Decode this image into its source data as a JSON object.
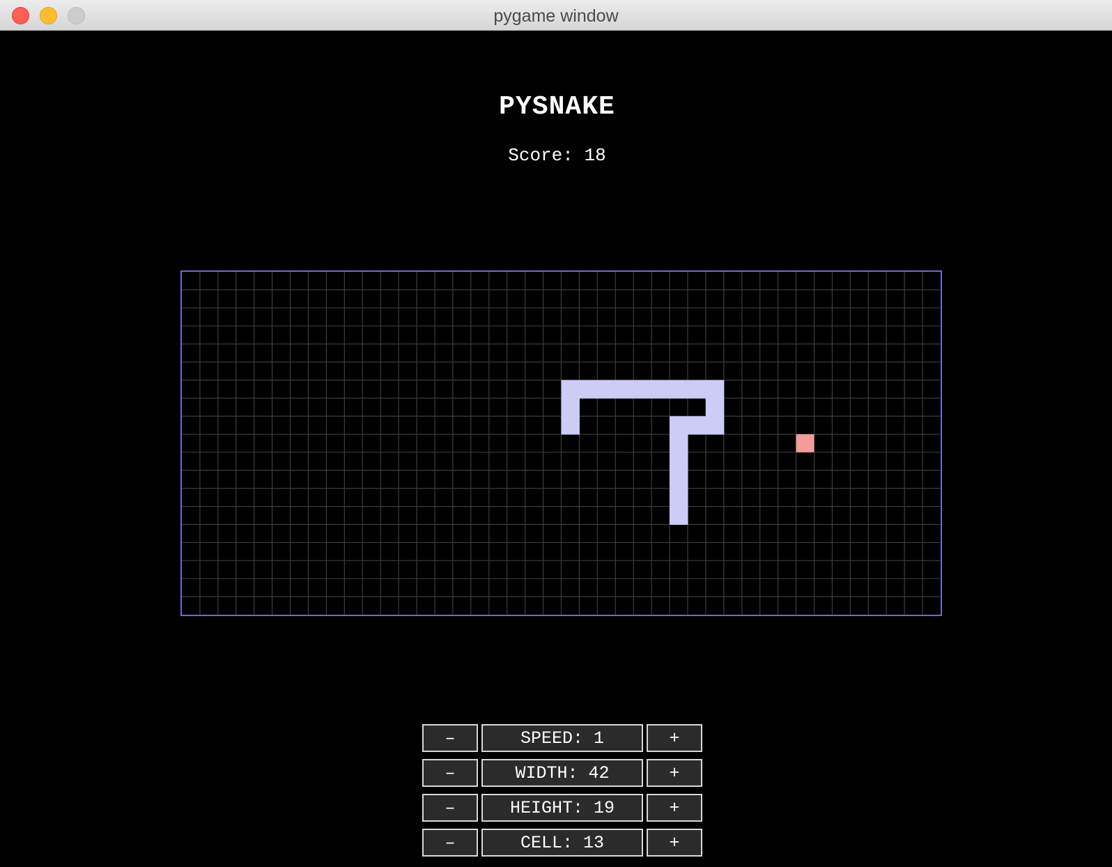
{
  "window": {
    "title": "pygame window"
  },
  "game": {
    "title": "PYSNAKE",
    "score_label": "Score:",
    "score_value": "18"
  },
  "board": {
    "columns": 42,
    "rows": 19,
    "border_color": "#6b6bd0",
    "grid_color": "#3c3c3c",
    "snake_color": "#ccccf7",
    "food_color": "#f39a9a",
    "snake_cells": [
      [
        21,
        8
      ],
      [
        21,
        7
      ],
      [
        21,
        6
      ],
      [
        22,
        6
      ],
      [
        23,
        6
      ],
      [
        24,
        6
      ],
      [
        25,
        6
      ],
      [
        26,
        6
      ],
      [
        27,
        6
      ],
      [
        28,
        6
      ],
      [
        29,
        6
      ],
      [
        29,
        7
      ],
      [
        29,
        8
      ],
      [
        28,
        8
      ],
      [
        27,
        8
      ],
      [
        27,
        9
      ],
      [
        27,
        10
      ],
      [
        27,
        11
      ],
      [
        27,
        12
      ],
      [
        27,
        13
      ]
    ],
    "food_cell": [
      34,
      9
    ]
  },
  "controls": [
    {
      "minus": "–",
      "label": "SPEED: 1",
      "plus": "+"
    },
    {
      "minus": "–",
      "label": "WIDTH: 42",
      "plus": "+"
    },
    {
      "minus": "–",
      "label": "HEIGHT: 19",
      "plus": "+"
    },
    {
      "minus": "–",
      "label": "CELL: 13",
      "plus": "+"
    }
  ]
}
